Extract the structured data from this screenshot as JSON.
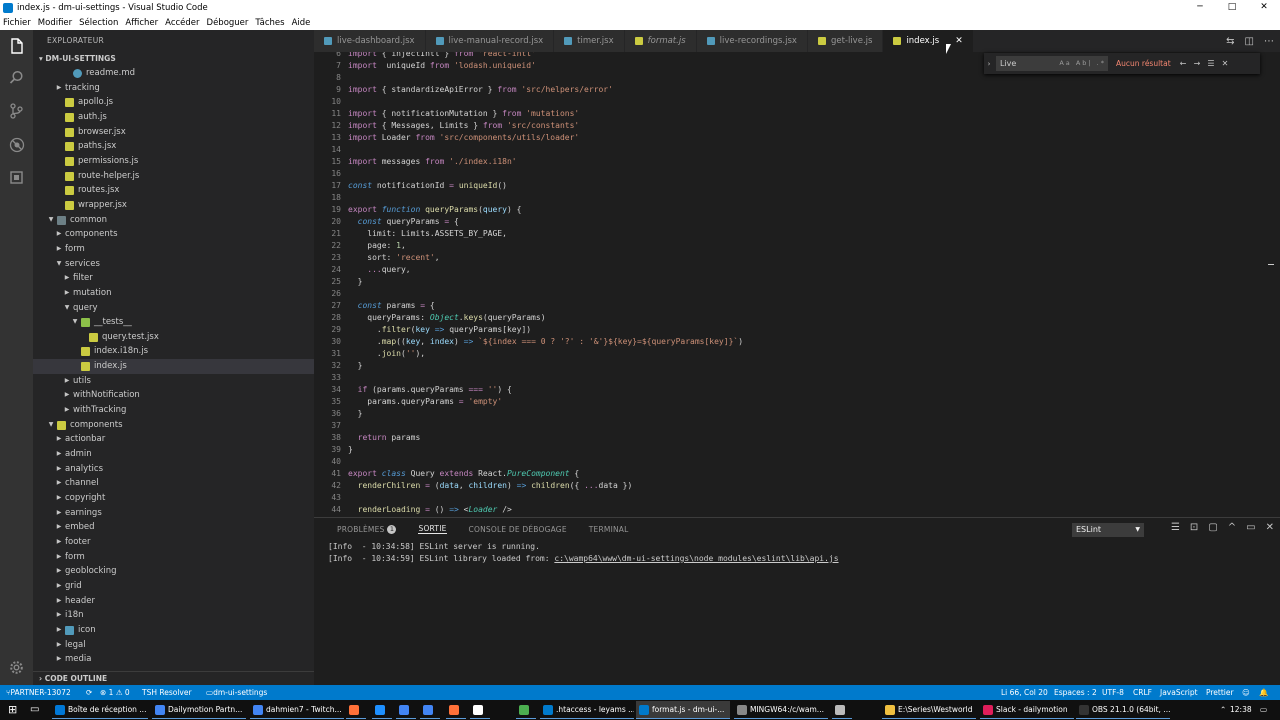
{
  "window": {
    "title": "index.js - dm-ui-settings - Visual Studio Code",
    "controls": [
      "─",
      "□",
      "✕"
    ]
  },
  "menu": [
    "Fichier",
    "Modifier",
    "Sélection",
    "Afficher",
    "Accéder",
    "Déboguer",
    "Tâches",
    "Aide"
  ],
  "sidebar": {
    "header": "EXPLORATEUR",
    "section": "DM-UI-SETTINGS",
    "outline": "CODE OUTLINE",
    "tree": [
      {
        "label": "readme.md",
        "depth": 4,
        "type": "file",
        "icon_color": "#519aba",
        "round": true
      },
      {
        "label": "tracking",
        "depth": 3,
        "type": "folder"
      },
      {
        "label": "apollo.js",
        "depth": 3,
        "type": "file",
        "icon_color": "#cbcb41"
      },
      {
        "label": "auth.js",
        "depth": 3,
        "type": "file",
        "icon_color": "#cbcb41"
      },
      {
        "label": "browser.jsx",
        "depth": 3,
        "type": "file",
        "icon_color": "#cbcb41"
      },
      {
        "label": "paths.jsx",
        "depth": 3,
        "type": "file",
        "icon_color": "#cbcb41"
      },
      {
        "label": "permissions.js",
        "depth": 3,
        "type": "file",
        "icon_color": "#cbcb41"
      },
      {
        "label": "route-helper.js",
        "depth": 3,
        "type": "file",
        "icon_color": "#cbcb41"
      },
      {
        "label": "routes.jsx",
        "depth": 3,
        "type": "file",
        "icon_color": "#cbcb41"
      },
      {
        "label": "wrapper.jsx",
        "depth": 3,
        "type": "file",
        "icon_color": "#cbcb41"
      },
      {
        "label": "common",
        "depth": 2,
        "type": "folder-open",
        "icon_color": "#6d8086"
      },
      {
        "label": "components",
        "depth": 3,
        "type": "folder"
      },
      {
        "label": "form",
        "depth": 3,
        "type": "folder"
      },
      {
        "label": "services",
        "depth": 3,
        "type": "folder-open"
      },
      {
        "label": "filter",
        "depth": 4,
        "type": "folder"
      },
      {
        "label": "mutation",
        "depth": 4,
        "type": "folder"
      },
      {
        "label": "query",
        "depth": 4,
        "type": "folder-open"
      },
      {
        "label": "__tests__",
        "depth": 5,
        "type": "folder-open",
        "icon_color": "#8dc149"
      },
      {
        "label": "query.test.jsx",
        "depth": 6,
        "type": "file",
        "icon_color": "#cbcb41"
      },
      {
        "label": "index.i18n.js",
        "depth": 5,
        "type": "file",
        "icon_color": "#cbcb41"
      },
      {
        "label": "index.js",
        "depth": 5,
        "type": "file",
        "icon_color": "#cbcb41",
        "selected": true
      },
      {
        "label": "utils",
        "depth": 4,
        "type": "folder"
      },
      {
        "label": "withNotification",
        "depth": 4,
        "type": "folder"
      },
      {
        "label": "withTracking",
        "depth": 4,
        "type": "folder"
      },
      {
        "label": "components",
        "depth": 2,
        "type": "folder-open",
        "icon_color": "#cbcb41"
      },
      {
        "label": "actionbar",
        "depth": 3,
        "type": "folder"
      },
      {
        "label": "admin",
        "depth": 3,
        "type": "folder"
      },
      {
        "label": "analytics",
        "depth": 3,
        "type": "folder"
      },
      {
        "label": "channel",
        "depth": 3,
        "type": "folder"
      },
      {
        "label": "copyright",
        "depth": 3,
        "type": "folder"
      },
      {
        "label": "earnings",
        "depth": 3,
        "type": "folder"
      },
      {
        "label": "embed",
        "depth": 3,
        "type": "folder"
      },
      {
        "label": "footer",
        "depth": 3,
        "type": "folder"
      },
      {
        "label": "form",
        "depth": 3,
        "type": "folder"
      },
      {
        "label": "geoblocking",
        "depth": 3,
        "type": "folder"
      },
      {
        "label": "grid",
        "depth": 3,
        "type": "folder"
      },
      {
        "label": "header",
        "depth": 3,
        "type": "folder"
      },
      {
        "label": "i18n",
        "depth": 3,
        "type": "folder"
      },
      {
        "label": "icon",
        "depth": 3,
        "type": "folder",
        "icon_color": "#519aba"
      },
      {
        "label": "legal",
        "depth": 3,
        "type": "folder"
      },
      {
        "label": "media",
        "depth": 3,
        "type": "folder"
      }
    ]
  },
  "tabs": [
    {
      "label": "live-dashboard.jsx",
      "icon_color": "#519aba"
    },
    {
      "label": "live-manual-record.jsx",
      "icon_color": "#519aba"
    },
    {
      "label": "timer.jsx",
      "icon_color": "#519aba"
    },
    {
      "label": "format.js",
      "icon_color": "#cbcb41",
      "italic": true
    },
    {
      "label": "live-recordings.jsx",
      "icon_color": "#519aba"
    },
    {
      "label": "get-live.js",
      "icon_color": "#cbcb41"
    },
    {
      "label": "index.js",
      "icon_color": "#cbcb41",
      "active": true,
      "close": "✕"
    }
  ],
  "find": {
    "query": "Live",
    "options": "Aa Ab| .*",
    "result": "Aucun résultat"
  },
  "code": [
    {
      "n": "7",
      "parts": [
        [
          "kw",
          "import"
        ],
        [
          "",
          "  uniqueId "
        ],
        [
          "kw",
          "from"
        ],
        [
          "",
          " "
        ],
        [
          "str",
          "'lodash.uniqueid'"
        ]
      ]
    },
    {
      "n": "8",
      "parts": []
    },
    {
      "n": "9",
      "parts": [
        [
          "kw",
          "import"
        ],
        [
          "",
          " { standardizeApiError } "
        ],
        [
          "kw",
          "from"
        ],
        [
          "",
          " "
        ],
        [
          "str",
          "'src/helpers/error'"
        ]
      ]
    },
    {
      "n": "10",
      "parts": []
    },
    {
      "n": "11",
      "parts": [
        [
          "kw",
          "import"
        ],
        [
          "",
          " { notificationMutation } "
        ],
        [
          "kw",
          "from"
        ],
        [
          "",
          " "
        ],
        [
          "str",
          "'mutations'"
        ]
      ]
    },
    {
      "n": "12",
      "parts": [
        [
          "kw",
          "import"
        ],
        [
          "",
          " { Messages, Limits } "
        ],
        [
          "kw",
          "from"
        ],
        [
          "",
          " "
        ],
        [
          "str",
          "'src/constants'"
        ]
      ]
    },
    {
      "n": "13",
      "parts": [
        [
          "kw",
          "import"
        ],
        [
          "",
          " Loader "
        ],
        [
          "kw",
          "from"
        ],
        [
          "",
          " "
        ],
        [
          "str",
          "'src/components/utils/loader'"
        ]
      ]
    },
    {
      "n": "14",
      "parts": []
    },
    {
      "n": "15",
      "parts": [
        [
          "kw",
          "import"
        ],
        [
          "",
          " messages "
        ],
        [
          "kw",
          "from"
        ],
        [
          "",
          " "
        ],
        [
          "str",
          "'./index.i18n'"
        ]
      ]
    },
    {
      "n": "16",
      "parts": []
    },
    {
      "n": "17",
      "parts": [
        [
          "kw2",
          "const"
        ],
        [
          "",
          " notificationId "
        ],
        [
          "kw",
          "="
        ],
        [
          "",
          " "
        ],
        [
          "fn",
          "uniqueId"
        ],
        [
          "",
          "()"
        ]
      ]
    },
    {
      "n": "18",
      "parts": []
    },
    {
      "n": "19",
      "parts": [
        [
          "kw",
          "export"
        ],
        [
          "",
          " "
        ],
        [
          "kw2",
          "function"
        ],
        [
          "",
          " "
        ],
        [
          "fn",
          "queryParams"
        ],
        [
          "",
          "("
        ],
        [
          "var",
          "query"
        ],
        [
          "",
          ") {"
        ]
      ]
    },
    {
      "n": "20",
      "parts": [
        [
          "",
          "  "
        ],
        [
          "kw2",
          "const"
        ],
        [
          "",
          " queryParams "
        ],
        [
          "kw",
          "="
        ],
        [
          "",
          " {"
        ]
      ]
    },
    {
      "n": "21",
      "parts": [
        [
          "",
          "    limit: Limits.ASSETS_BY_PAGE,"
        ]
      ]
    },
    {
      "n": "22",
      "parts": [
        [
          "",
          "    page: "
        ],
        [
          "num",
          "1"
        ],
        [
          "",
          ","
        ]
      ]
    },
    {
      "n": "23",
      "parts": [
        [
          "",
          "    sort: "
        ],
        [
          "str",
          "'recent'"
        ],
        [
          "",
          ","
        ]
      ]
    },
    {
      "n": "24",
      "parts": [
        [
          "",
          "    "
        ],
        [
          "kw",
          "..."
        ],
        [
          "",
          "query,"
        ]
      ]
    },
    {
      "n": "25",
      "parts": [
        [
          "",
          "  }"
        ]
      ]
    },
    {
      "n": "26",
      "parts": []
    },
    {
      "n": "27",
      "parts": [
        [
          "",
          "  "
        ],
        [
          "kw2",
          "const"
        ],
        [
          "",
          " params "
        ],
        [
          "kw",
          "="
        ],
        [
          "",
          " {"
        ]
      ]
    },
    {
      "n": "28",
      "parts": [
        [
          "",
          "    queryParams: "
        ],
        [
          "typ",
          "Object"
        ],
        [
          "",
          "."
        ],
        [
          "fn",
          "keys"
        ],
        [
          "",
          "(queryParams)"
        ]
      ]
    },
    {
      "n": "29",
      "parts": [
        [
          "",
          "      ."
        ],
        [
          "fn",
          "filter"
        ],
        [
          "",
          "("
        ],
        [
          "var",
          "key"
        ],
        [
          "",
          " "
        ],
        [
          "kw2",
          "=>"
        ],
        [
          "",
          " queryParams[key])"
        ]
      ]
    },
    {
      "n": "30",
      "parts": [
        [
          "",
          "      ."
        ],
        [
          "fn",
          "map"
        ],
        [
          "",
          "(("
        ],
        [
          "var",
          "key"
        ],
        [
          "",
          ", "
        ],
        [
          "var",
          "index"
        ],
        [
          "",
          ") "
        ],
        [
          "kw2",
          "=>"
        ],
        [
          "",
          " "
        ],
        [
          "str",
          "`${index === 0 ? '?' : '&'}${key}=${queryParams[key]}`"
        ],
        [
          "",
          ")"
        ]
      ]
    },
    {
      "n": "31",
      "parts": [
        [
          "",
          "      ."
        ],
        [
          "fn",
          "join"
        ],
        [
          "",
          "("
        ],
        [
          "str",
          "''"
        ],
        [
          "",
          "),"
        ]
      ]
    },
    {
      "n": "32",
      "parts": [
        [
          "",
          "  }"
        ]
      ]
    },
    {
      "n": "33",
      "parts": []
    },
    {
      "n": "34",
      "parts": [
        [
          "",
          "  "
        ],
        [
          "kw",
          "if"
        ],
        [
          "",
          " (params.queryParams "
        ],
        [
          "kw",
          "==="
        ],
        [
          "",
          " "
        ],
        [
          "str",
          "''"
        ],
        [
          "",
          ") {"
        ]
      ]
    },
    {
      "n": "35",
      "parts": [
        [
          "",
          "    params.queryParams "
        ],
        [
          "kw",
          "="
        ],
        [
          "",
          " "
        ],
        [
          "str",
          "'empty'"
        ]
      ]
    },
    {
      "n": "36",
      "parts": [
        [
          "",
          "  }"
        ]
      ]
    },
    {
      "n": "37",
      "parts": []
    },
    {
      "n": "38",
      "parts": [
        [
          "",
          "  "
        ],
        [
          "kw",
          "return"
        ],
        [
          "",
          " params"
        ]
      ]
    },
    {
      "n": "39",
      "parts": [
        [
          "",
          "}"
        ]
      ]
    },
    {
      "n": "40",
      "parts": []
    },
    {
      "n": "41",
      "parts": [
        [
          "kw",
          "export"
        ],
        [
          "",
          " "
        ],
        [
          "kw2",
          "class"
        ],
        [
          "",
          " Query "
        ],
        [
          "kw",
          "extends"
        ],
        [
          "",
          " React."
        ],
        [
          "typ",
          "PureComponent"
        ],
        [
          "",
          " {"
        ]
      ]
    },
    {
      "n": "42",
      "parts": [
        [
          "",
          "  "
        ],
        [
          "fn",
          "renderChilren"
        ],
        [
          "",
          " "
        ],
        [
          "kw",
          "="
        ],
        [
          "",
          " ("
        ],
        [
          "var",
          "data"
        ],
        [
          "",
          ", "
        ],
        [
          "var",
          "children"
        ],
        [
          "",
          ") "
        ],
        [
          "kw2",
          "=>"
        ],
        [
          "",
          " "
        ],
        [
          "fn",
          "children"
        ],
        [
          "",
          "({ "
        ],
        [
          "kw",
          "..."
        ],
        [
          "",
          "data })"
        ]
      ]
    },
    {
      "n": "43",
      "parts": []
    },
    {
      "n": "44",
      "parts": [
        [
          "",
          "  "
        ],
        [
          "fn",
          "renderLoading"
        ],
        [
          "",
          " "
        ],
        [
          "kw",
          "="
        ],
        [
          "",
          " () "
        ],
        [
          "kw2",
          "=>"
        ],
        [
          "",
          " <"
        ],
        [
          "typ",
          "Loader"
        ],
        [
          "",
          " />"
        ]
      ]
    }
  ],
  "panel": {
    "tabs": [
      "PROBLÈMES",
      "SORTIE",
      "CONSOLE DE DÉBOGAGE",
      "TERMINAL"
    ],
    "problems_count": "1",
    "active_tab": "SORTIE",
    "channel": "ESLint",
    "output": [
      {
        "text": "[Info  - 10:34:58] ESLint server is running.",
        "link": ""
      },
      {
        "text": "[Info  - 10:34:59] ESLint library loaded from: ",
        "link": "c:\\wamp64\\www\\dm-ui-settings\\node_modules\\eslint\\lib\\api.js"
      }
    ]
  },
  "status": {
    "branch": "PARTNER-13072",
    "sync": "⟳",
    "errors": "⊗ 1 ⚠ 0",
    "tsh": "TSH Resolver",
    "folder": "dm-ui-settings",
    "position": "Li 66, Col 20",
    "spaces": "Espaces : 2",
    "encoding": "UTF-8",
    "eol": "CRLF",
    "language": "JavaScript",
    "formatter": "Prettier",
    "smiley": "☺",
    "bell": "🔔"
  },
  "taskbar": {
    "tasks": [
      {
        "label": "Boîte de réception ...",
        "color": "#0078d7"
      },
      {
        "label": "Dailymotion Partn...",
        "color": "#4285f4"
      },
      {
        "label": "dahmien7 - Twitch...",
        "color": "#4285f4"
      },
      {
        "label": "",
        "color": "#ff7139"
      },
      {
        "label": "",
        "color": "#1e90ff"
      },
      {
        "label": "",
        "color": "#4285f4"
      },
      {
        "label": "",
        "color": "#4285f4"
      },
      {
        "label": "",
        "color": "#ff7139"
      },
      {
        "label": "",
        "color": "#ffffff"
      },
      {
        "label": "",
        "color": "#4caf50"
      },
      {
        "label": ".htaccess - leyams ...",
        "color": "#007acc"
      },
      {
        "label": "format.js - dm-ui-...",
        "color": "#007acc",
        "active": true
      },
      {
        "label": "MINGW64:/c/wam...",
        "color": "#888888"
      },
      {
        "label": "",
        "color": "#bbbbbb"
      },
      {
        "label": "E:\\Series\\Westworld",
        "color": "#f0c040"
      },
      {
        "label": "Slack - dailymotion",
        "color": "#e01e5a"
      },
      {
        "label": "OBS 21.1.0 (64bit, ...",
        "color": "#333333"
      }
    ],
    "clock": "12:38"
  }
}
